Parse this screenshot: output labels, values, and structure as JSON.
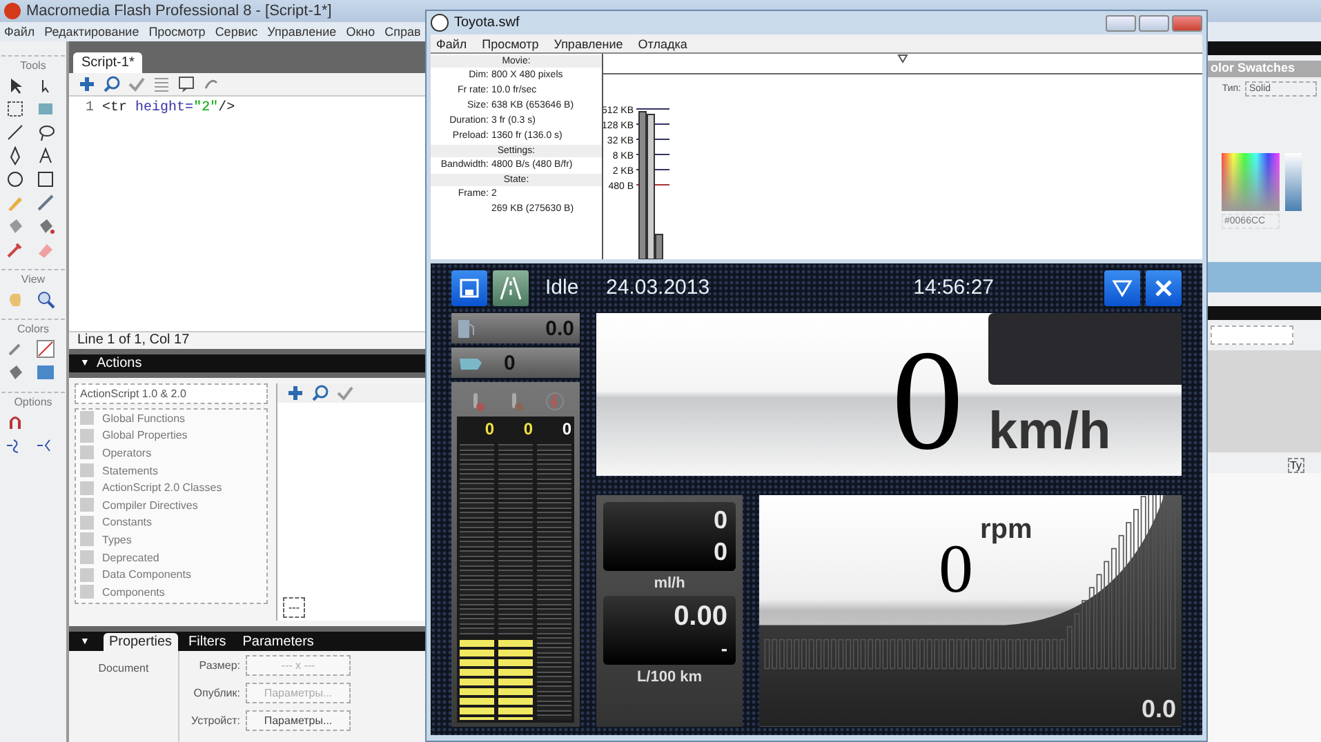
{
  "app": {
    "title": "Macromedia Flash Professional 8 - [Script-1*]",
    "menu": [
      "Файл",
      "Редактирование",
      "Просмотр",
      "Сервис",
      "Управление",
      "Окно",
      "Справ"
    ]
  },
  "tools": {
    "sections": [
      "Tools",
      "View",
      "Colors",
      "Options"
    ]
  },
  "script": {
    "tab": "Script-1*",
    "lines": [
      {
        "number": "1",
        "tag": "<tr",
        "attr": "height=",
        "value": "\"2\"",
        "end": "/>"
      }
    ],
    "status": "Line 1 of 1, Col 17"
  },
  "actions": {
    "collapse": "▼",
    "title": "Actions",
    "version": "ActionScript 1.0 & 2.0",
    "items": [
      "Global Functions",
      "Global Properties",
      "Operators",
      "Statements",
      "ActionScript 2.0 Classes",
      "Compiler Directives",
      "Constants",
      "Types",
      "Deprecated",
      "Data Components",
      "Components"
    ],
    "pin": "---"
  },
  "properties": {
    "collapse": "▼",
    "tabs": [
      {
        "label": "Properties",
        "selected": true
      },
      {
        "label": "Filters",
        "selected": false
      },
      {
        "label": "Parameters",
        "selected": false
      }
    ],
    "document": "Document",
    "fields": [
      {
        "label": "Размер:",
        "value": "--- x ---",
        "disabled": true
      },
      {
        "label": "Опублик:",
        "value": "Параметры...",
        "disabled": true
      },
      {
        "label": "Устройст:",
        "value": "Параметры...",
        "disabled": false
      }
    ]
  },
  "swatches": {
    "title": "olor Swatches",
    "type_label": "Тип:",
    "type_value": "Solid",
    "hex": "#0066CC",
    "library_label": "Ty"
  },
  "player": {
    "title": "Toyota.swf",
    "menu": [
      "Файл",
      "Просмотр",
      "Управление",
      "Отладка"
    ],
    "profiler": {
      "sections": [
        {
          "heading": "Movie:",
          "rows": [
            {
              "label": "Dim:",
              "value": "800 X 480 pixels"
            },
            {
              "label": "Fr rate:",
              "value": "10.0 fr/sec"
            },
            {
              "label": "Size:",
              "value": "638 KB (653646 B)"
            },
            {
              "label": "Duration:",
              "value": "3 fr (0.3 s)"
            },
            {
              "label": "Preload:",
              "value": "1360 fr (136.0 s)"
            }
          ]
        },
        {
          "heading": "Settings:",
          "rows": [
            {
              "label": "Bandwidth:",
              "value": "4800 B/s (480 B/fr)"
            }
          ]
        },
        {
          "heading": "State:",
          "rows": [
            {
              "label": "Frame:",
              "value": "2"
            },
            {
              "value": "269 KB (275630 B)"
            }
          ]
        }
      ],
      "scale_labels": [
        "512 KB",
        "128 KB",
        "32 KB",
        "8 KB",
        "2 KB",
        "480 B"
      ]
    }
  },
  "dashboard": {
    "status": "Idle",
    "date": "24.03.2013",
    "time": "14:56:27",
    "fuel": "0.0",
    "engine": "0",
    "gauges": [
      {
        "reading": "0",
        "color": "#f0e040",
        "level": 0.3
      },
      {
        "reading": "0",
        "color": "#f0e040",
        "level": 0.3
      },
      {
        "reading": "0",
        "color": "#ffffff",
        "level": 0
      }
    ],
    "speed": "0",
    "speed_unit": "km/h",
    "flow": [
      "0",
      "0"
    ],
    "flow_unit": "ml/h",
    "consumption": "0.00",
    "consumption_sub": "-",
    "consumption_unit": "L/100 km",
    "rpm": "0",
    "rpm_unit": "rpm",
    "rpm_reading": "0.0"
  }
}
